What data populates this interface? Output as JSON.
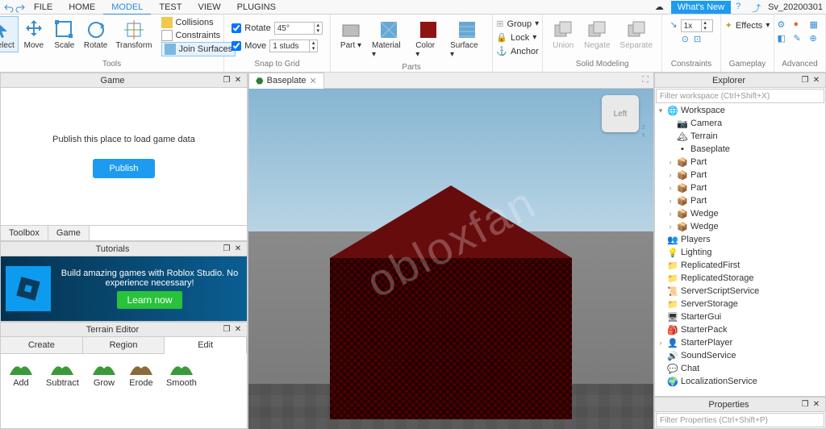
{
  "menubar": {
    "items": [
      "FILE",
      "HOME",
      "MODEL",
      "TEST",
      "VIEW",
      "PLUGINS"
    ],
    "active": 2,
    "whats_new": "What's New",
    "user": "Sv_20200301"
  },
  "ribbon": {
    "tools": {
      "label": "Tools",
      "buttons": [
        "Select",
        "Move",
        "Scale",
        "Rotate",
        "Transform"
      ],
      "selected": 0,
      "collisions": "Collisions",
      "constraints": "Constraints",
      "join": "Join Surfaces"
    },
    "snap": {
      "label": "Snap to Grid",
      "rotate": "Rotate",
      "rotate_val": "45°",
      "move": "Move",
      "move_val": "1 studs"
    },
    "parts": {
      "label": "Parts",
      "buttons": [
        "Part",
        "Material",
        "Color",
        "Surface"
      ]
    },
    "misc": {
      "group": "Group",
      "lock": "Lock",
      "anchor": "Anchor"
    },
    "solid": {
      "label": "Solid Modeling",
      "buttons": [
        "Union",
        "Negate",
        "Separate"
      ]
    },
    "constraints": {
      "label": "Constraints",
      "val": "1x"
    },
    "gameplay": {
      "label": "Gameplay",
      "effects": "Effects"
    },
    "advanced": {
      "label": "Advanced"
    }
  },
  "left": {
    "game": {
      "title": "Game",
      "msg": "Publish this place to load game data",
      "btn": "Publish",
      "tabs": [
        "Toolbox",
        "Game"
      ]
    },
    "tutorials": {
      "title": "Tutorials",
      "text": "Build amazing games with Roblox Studio. No experience necessary!",
      "btn": "Learn now"
    },
    "terrain": {
      "title": "Terrain Editor",
      "tabs": [
        "Create",
        "Region",
        "Edit"
      ],
      "active": 2,
      "tools": [
        "Add",
        "Subtract",
        "Grow",
        "Erode",
        "Smooth"
      ]
    }
  },
  "doc": {
    "tab": "Baseplate",
    "cube": "Left"
  },
  "explorer": {
    "title": "Explorer",
    "filter": "Filter workspace (Ctrl+Shift+X)",
    "nodes": [
      {
        "l": 0,
        "exp": "▾",
        "ic": "globe",
        "t": "Workspace"
      },
      {
        "l": 1,
        "exp": "",
        "ic": "cam",
        "t": "Camera"
      },
      {
        "l": 1,
        "exp": "",
        "ic": "terrain",
        "t": "Terrain"
      },
      {
        "l": 1,
        "exp": "",
        "ic": "base",
        "t": "Baseplate"
      },
      {
        "l": 1,
        "exp": "›",
        "ic": "part",
        "t": "Part"
      },
      {
        "l": 1,
        "exp": "›",
        "ic": "part",
        "t": "Part"
      },
      {
        "l": 1,
        "exp": "›",
        "ic": "part",
        "t": "Part"
      },
      {
        "l": 1,
        "exp": "›",
        "ic": "part",
        "t": "Part"
      },
      {
        "l": 1,
        "exp": "›",
        "ic": "part",
        "t": "Wedge"
      },
      {
        "l": 1,
        "exp": "›",
        "ic": "part",
        "t": "Wedge"
      },
      {
        "l": 0,
        "exp": "",
        "ic": "players",
        "t": "Players"
      },
      {
        "l": 0,
        "exp": "",
        "ic": "light",
        "t": "Lighting"
      },
      {
        "l": 0,
        "exp": "",
        "ic": "folder",
        "t": "ReplicatedFirst"
      },
      {
        "l": 0,
        "exp": "",
        "ic": "folder",
        "t": "ReplicatedStorage"
      },
      {
        "l": 0,
        "exp": "",
        "ic": "script",
        "t": "ServerScriptService"
      },
      {
        "l": 0,
        "exp": "",
        "ic": "folder",
        "t": "ServerStorage"
      },
      {
        "l": 0,
        "exp": "",
        "ic": "gui",
        "t": "StarterGui"
      },
      {
        "l": 0,
        "exp": "",
        "ic": "pack",
        "t": "StarterPack"
      },
      {
        "l": 0,
        "exp": "›",
        "ic": "player",
        "t": "StarterPlayer"
      },
      {
        "l": 0,
        "exp": "",
        "ic": "sound",
        "t": "SoundService"
      },
      {
        "l": 0,
        "exp": "",
        "ic": "chat",
        "t": "Chat"
      },
      {
        "l": 0,
        "exp": "",
        "ic": "globe2",
        "t": "LocalizationService"
      }
    ]
  },
  "props": {
    "title": "Properties",
    "filter": "Filter Properties (Ctrl+Shift+P)"
  },
  "watermark": "obloxfan"
}
